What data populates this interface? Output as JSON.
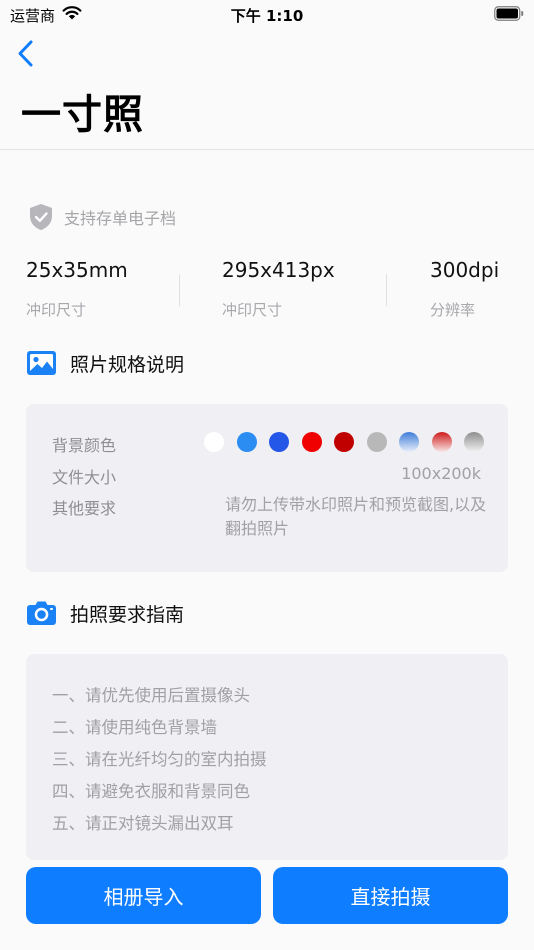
{
  "status_bar": {
    "carrier": "运营商",
    "time": "下午 1:10"
  },
  "header": {
    "title": "一寸照"
  },
  "support": {
    "text": "支持存单电子档"
  },
  "specs": [
    {
      "value": "25x35mm",
      "label": "冲印尺寸"
    },
    {
      "value": "295x413px",
      "label": "冲印尺寸"
    },
    {
      "value": "300dpi",
      "label": "分辨率"
    }
  ],
  "photo_spec": {
    "title": "照片规格说明",
    "bg_color_label": "背景颜色",
    "bg_colors": [
      "#ffffff",
      "#2b8cf2",
      "#2457e8",
      "#f00000",
      "#c00000",
      "#b8b8b8",
      "gradient-blue",
      "gradient-red",
      "gradient-gray"
    ],
    "file_size_label": "文件大小",
    "file_size_value": "100x200k",
    "other_label": "其他要求",
    "other_value": "请勿上传带水印照片和预览截图,以及翻拍照片"
  },
  "guide": {
    "title": "拍照要求指南",
    "items": [
      "一、请优先使用后置摄像头",
      "二、请使用纯色背景墙",
      "三、请在光纤均匀的室内拍摄",
      "四、请避免衣服和背景同色",
      "五、请正对镜头漏出双耳"
    ]
  },
  "buttons": {
    "import_label": "相册导入",
    "shoot_label": "直接拍摄"
  },
  "colors": {
    "accent": "#0f7dff",
    "card_bg": "#f0f0f4"
  }
}
